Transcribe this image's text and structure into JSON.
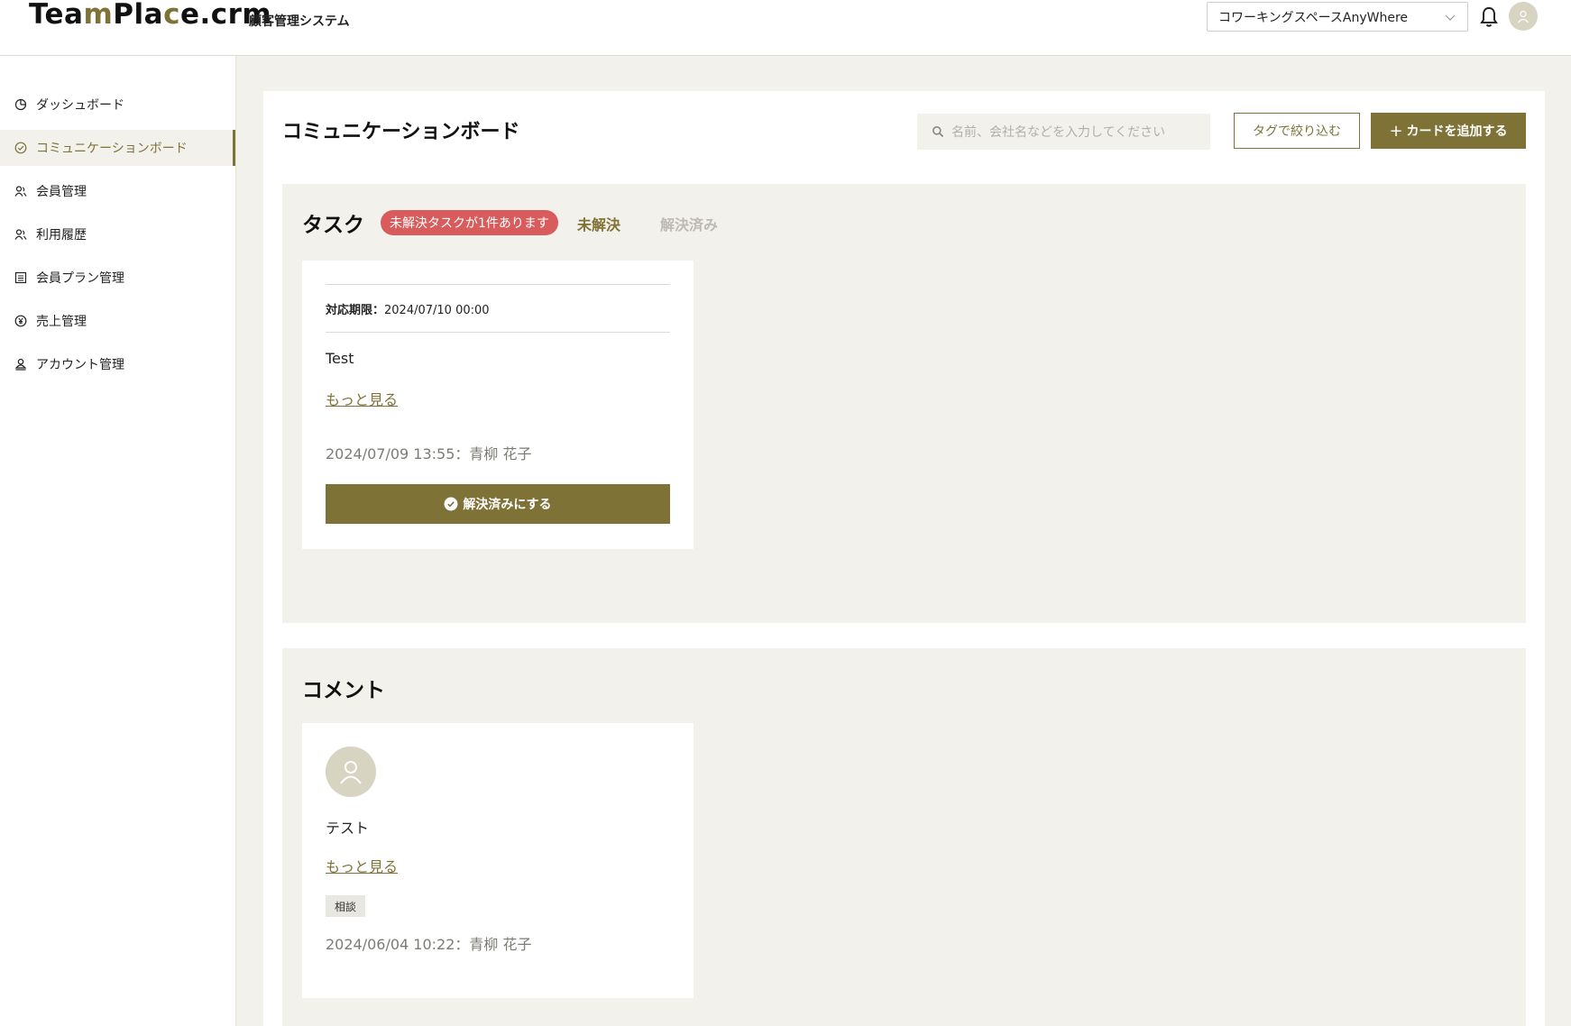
{
  "header": {
    "logo_part1": "Tea",
    "logo_part2": "m",
    "logo_part3": "Pla",
    "logo_part4": "c",
    "logo_part5": "e.crm",
    "subtitle": "顧客管理システム",
    "space_selected": "コワーキングスペースAnyWhere"
  },
  "sidebar": {
    "items": [
      {
        "label": "ダッシュボード",
        "icon": "dashboard-icon"
      },
      {
        "label": "コミュニケーションボード",
        "icon": "check-circle-icon",
        "active": true
      },
      {
        "label": "会員管理",
        "icon": "members-icon"
      },
      {
        "label": "利用履歴",
        "icon": "history-icon"
      },
      {
        "label": "会員プラン管理",
        "icon": "plan-icon"
      },
      {
        "label": "売上管理",
        "icon": "yen-icon"
      },
      {
        "label": "アカウント管理",
        "icon": "account-icon"
      }
    ]
  },
  "main": {
    "title": "コミュニケーションボード",
    "search_placeholder": "名前、会社名などを入力してください",
    "filter_button": "タグで絞り込む",
    "add_button": "カードを追加する"
  },
  "tasks": {
    "title": "タスク",
    "badge": "未解決タスクが1件あります",
    "tab_unresolved": "未解決",
    "tab_resolved": "解決済み",
    "card": {
      "deadline_label": "対応期限：",
      "deadline_value": "2024/07/10 00:00",
      "text": "Test",
      "more": "もっと見る",
      "meta": "2024/07/09 13:55：青柳 花子",
      "resolve_button": "解決済みにする"
    }
  },
  "comments": {
    "title": "コメント",
    "card": {
      "text": "テスト",
      "more": "もっと見る",
      "tag": "相談",
      "meta": "2024/06/04 10:22：青柳 花子"
    }
  },
  "colors": {
    "accent": "#7e7236",
    "badge_red": "#d95c5c",
    "bg": "#f2f1ec"
  }
}
